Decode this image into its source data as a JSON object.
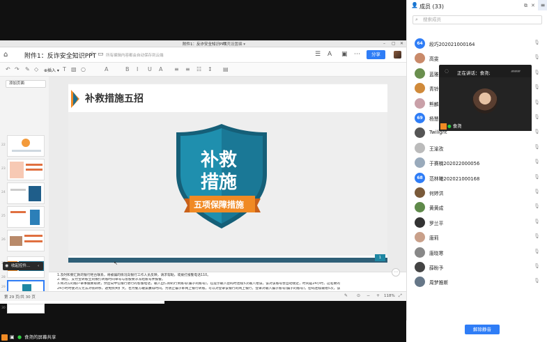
{
  "ppt": {
    "window_title": "附件1：反诈安全知识PPT",
    "window_tag": "稿壳设置编 ▾",
    "doc_title": "附件1：反诈安全知识PPT",
    "saved_status": "所有编辑内容都会自动保存到云端",
    "share_label": "分享",
    "toolbar_insert": "⊕插入 ▾",
    "thumb_select": "添加页面",
    "thumb_numbers": [
      "22",
      "23",
      "24",
      "25",
      "26",
      "27",
      "28",
      "29",
      "30"
    ],
    "slide": {
      "title": "补救措施五招",
      "shield_line1": "补救",
      "shield_line2": "措施",
      "ribbon": "五项保障措施",
      "page_no": "1"
    },
    "notes": [
      "1.及时和要汇款的银行柜台联系，将被骗的情况向银行工作人员反映，请求帮助，或拨打报警电话110。",
      "2. 微信、支付宝转账立刻拨打转账时间单号与客服要求冻结账号并报警。",
      "3.将对方的账户录事据要取款，然后向中信银行进行的客服电话，输入自仁即的行到账号(骗子的账号)，在提示输入密码时连续5次输入错误，该对该账号会自动锁定，时间是24小时，这笔要的",
      "24小时时使对方无法对钱转移，避免损失扩大。也为警方破案赢得时间。为防止骗子即网上银行转账，可以对登录该银行的网上银行，登录对输入骗子账号(骗子的账号)，密码连续输错5次，该"
    ],
    "status_page": "第 29 页/共 30 页",
    "zoom": "118%",
    "collapse_label": "收起控件..."
  },
  "share_status": "食尧的屏幕共享",
  "speaker": {
    "label": "正在讲话：食尧;",
    "name": "食尧"
  },
  "panel": {
    "title": "成员 (33)",
    "search_placeholder": "搜索成员",
    "unmute_label": "解除静音",
    "members": [
      {
        "name": "段巧202021000164",
        "badge": "64",
        "color": "#2f7df6"
      },
      {
        "name": "高雯",
        "badge": "",
        "color": "#c98a6a"
      },
      {
        "name": "蓝雅",
        "badge": "",
        "color": "#6a8f4e"
      },
      {
        "name": "青铃",
        "badge": "",
        "color": "#d08a3a"
      },
      {
        "name": "熊麟",
        "badge": "",
        "color": "#c9a0a8"
      },
      {
        "name": "杨慧",
        "badge": "69",
        "color": "#2f7df6"
      },
      {
        "name": "Twilight",
        "badge": "",
        "color": "#555555"
      },
      {
        "name": "王渝孜",
        "badge": "",
        "color": "#bbbbbb"
      },
      {
        "name": "于赛楠202022000056",
        "badge": "",
        "color": "#99aabb"
      },
      {
        "name": "范林曦202021000168",
        "badge": "68",
        "color": "#2f7df6"
      },
      {
        "name": "何婷洪",
        "badge": "",
        "color": "#7a5a3a"
      },
      {
        "name": "黄黄成",
        "badge": "",
        "color": "#5f8a4a"
      },
      {
        "name": "罗兰平",
        "badge": "",
        "color": "#333333"
      },
      {
        "name": "唐莉",
        "badge": "",
        "color": "#c9a08a"
      },
      {
        "name": "唐晓寒",
        "badge": "",
        "color": "#888888"
      },
      {
        "name": "薛盼予",
        "badge": "",
        "color": "#444444"
      },
      {
        "name": "周梦推斯",
        "badge": "",
        "color": "#667788"
      }
    ]
  }
}
